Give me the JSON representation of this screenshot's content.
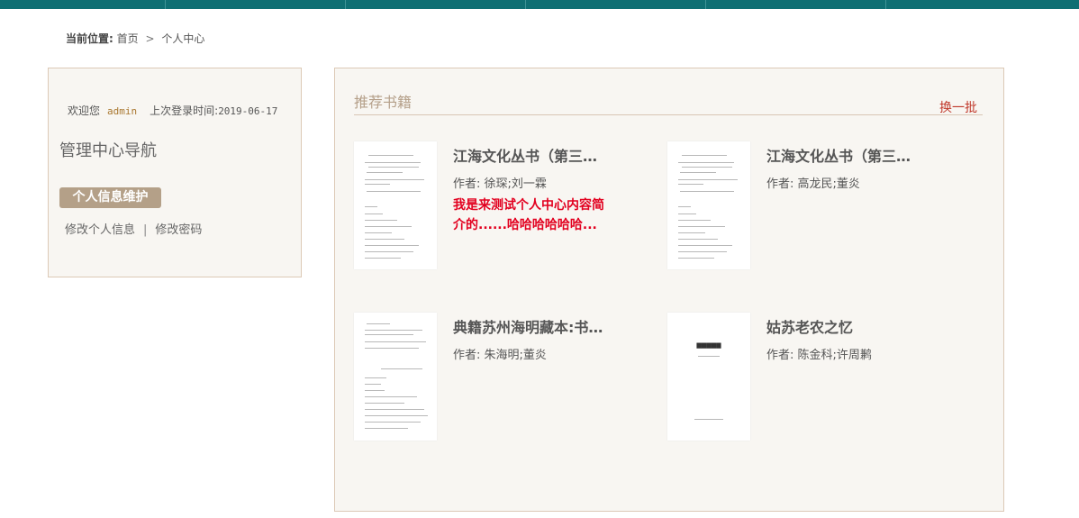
{
  "breadcrumb": {
    "label": "当前位置:",
    "home": "首页",
    "separator": ">",
    "current": "个人中心"
  },
  "sidebar": {
    "welcome_label": "欢迎您",
    "username": "admin",
    "last_login_label": "上次登录时间:",
    "last_login_date": "2019-06-17",
    "nav_title": "管理中心导航",
    "section_badge": "个人信息维护",
    "links": {
      "edit_profile": "修改个人信息",
      "divider": "|",
      "change_password": "修改密码"
    }
  },
  "recommend": {
    "title": "推荐书籍",
    "refresh_label": "换一批",
    "books": [
      {
        "title": "江海文化丛书（第三…",
        "author": "作者: 徐琛;刘一霖",
        "desc": "我是来测试个人中心内容简介的......哈哈哈哈哈哈..."
      },
      {
        "title": "江海文化丛书（第三…",
        "author": "作者: 高龙民;董炎",
        "desc": ""
      },
      {
        "title": "典籍苏州海明藏本:书…",
        "author": "作者: 朱海明;董炎",
        "desc": ""
      },
      {
        "title": "姑苏老农之忆",
        "author": "作者: 陈金科;许周鹣",
        "desc": ""
      }
    ]
  },
  "colors": {
    "topbar": "#0f6f73",
    "accent": "#b4a088",
    "highlight": "#e2001f"
  }
}
